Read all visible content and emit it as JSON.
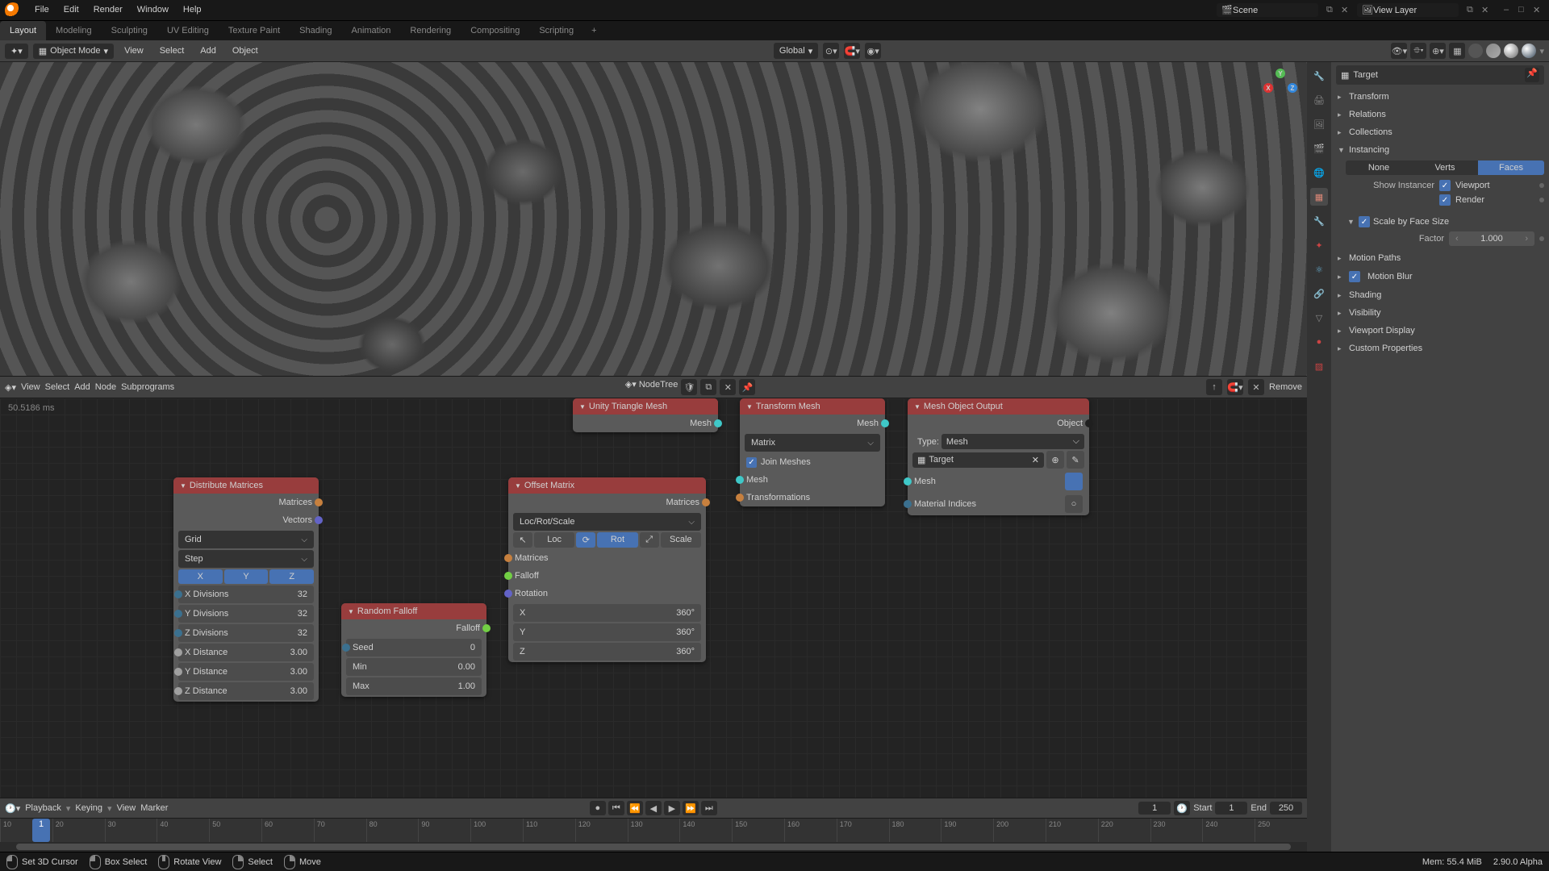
{
  "menubar": {
    "items": [
      "File",
      "Edit",
      "Render",
      "Window",
      "Help"
    ]
  },
  "workspaces": {
    "tabs": [
      "Layout",
      "Modeling",
      "Sculpting",
      "UV Editing",
      "Texture Paint",
      "Shading",
      "Animation",
      "Rendering",
      "Compositing",
      "Scripting"
    ],
    "active": "Layout"
  },
  "scene": {
    "label": "Scene"
  },
  "viewlayer": {
    "label": "View Layer"
  },
  "viewheader": {
    "mode": "Object Mode",
    "menus": [
      "View",
      "Select",
      "Add",
      "Object"
    ],
    "orientation": "Global"
  },
  "nodeheader": {
    "menus": [
      "View",
      "Select",
      "Add",
      "Node",
      "Subprograms"
    ],
    "tree": "NodeTree",
    "remove": "Remove"
  },
  "timing": "50.5186 ms",
  "nodes": {
    "distribute": {
      "title": "Distribute Matrices",
      "out_matrices": "Matrices",
      "out_vectors": "Vectors",
      "mode1": "Grid",
      "mode2": "Step",
      "axes": [
        "X",
        "Y",
        "Z"
      ],
      "fields": [
        {
          "label": "X Divisions",
          "value": "32"
        },
        {
          "label": "Y Divisions",
          "value": "32"
        },
        {
          "label": "Z Divisions",
          "value": "32"
        },
        {
          "label": "X Distance",
          "value": "3.00"
        },
        {
          "label": "Y Distance",
          "value": "3.00"
        },
        {
          "label": "Z Distance",
          "value": "3.00"
        }
      ]
    },
    "randfall": {
      "title": "Random Falloff",
      "out": "Falloff",
      "seed": {
        "label": "Seed",
        "value": "0"
      },
      "min": {
        "label": "Min",
        "value": "0.00"
      },
      "max": {
        "label": "Max",
        "value": "1.00"
      }
    },
    "offset": {
      "title": "Offset Matrix",
      "out": "Matrices",
      "dd": "Loc/Rot/Scale",
      "tabs": [
        "Loc",
        "Rot",
        "Scale"
      ],
      "in_matrices": "Matrices",
      "in_falloff": "Falloff",
      "rotation_label": "Rotation",
      "rx": {
        "l": "X",
        "v": "360°"
      },
      "ry": {
        "l": "Y",
        "v": "360°"
      },
      "rz": {
        "l": "Z",
        "v": "360°"
      }
    },
    "unity": {
      "title": "Unity Triangle Mesh",
      "out": "Mesh"
    },
    "transform": {
      "title": "Transform Mesh",
      "out": "Mesh",
      "dd": "Matrix",
      "join": "Join Meshes",
      "in_mesh": "Mesh",
      "in_trans": "Transformations"
    },
    "output": {
      "title": "Mesh Object Output",
      "out": "Object",
      "type_label": "Type:",
      "type": "Mesh",
      "target": "Target",
      "in_mesh": "Mesh",
      "in_mat": "Material Indices"
    }
  },
  "props": {
    "crumb": "Target",
    "pin": "📌",
    "sections": {
      "transform": "Transform",
      "relations": "Relations",
      "collections": "Collections",
      "instancing": "Instancing",
      "motion_paths": "Motion Paths",
      "motion_blur": "Motion Blur",
      "shading": "Shading",
      "visibility": "Visibility",
      "viewport_display": "Viewport Display",
      "custom_props": "Custom Properties"
    },
    "instancing": {
      "tabs": [
        "None",
        "Verts",
        "Faces"
      ],
      "active": "Faces",
      "show_instancer": "Show Instancer",
      "viewport": "Viewport",
      "render": "Render",
      "scale_by_face": "Scale by Face Size",
      "factor_label": "Factor",
      "factor": "1.000"
    }
  },
  "outliner": {
    "target": "Target"
  },
  "timeline": {
    "menus": [
      "Playback",
      "Keying",
      "View",
      "Marker"
    ],
    "current": "1",
    "start_label": "Start",
    "start": "1",
    "end_label": "End",
    "end": "250",
    "ticks": [
      "10",
      "20",
      "30",
      "40",
      "50",
      "60",
      "70",
      "80",
      "90",
      "100",
      "110",
      "120",
      "130",
      "140",
      "150",
      "160",
      "170",
      "180",
      "190",
      "200",
      "210",
      "220",
      "230",
      "240",
      "250"
    ]
  },
  "status": {
    "cursor": "Set 3D Cursor",
    "box": "Box Select",
    "rotate": "Rotate View",
    "select": "Select",
    "move": "Move",
    "mem": "Mem: 55.4 MiB",
    "ver": "2.90.0 Alpha"
  }
}
